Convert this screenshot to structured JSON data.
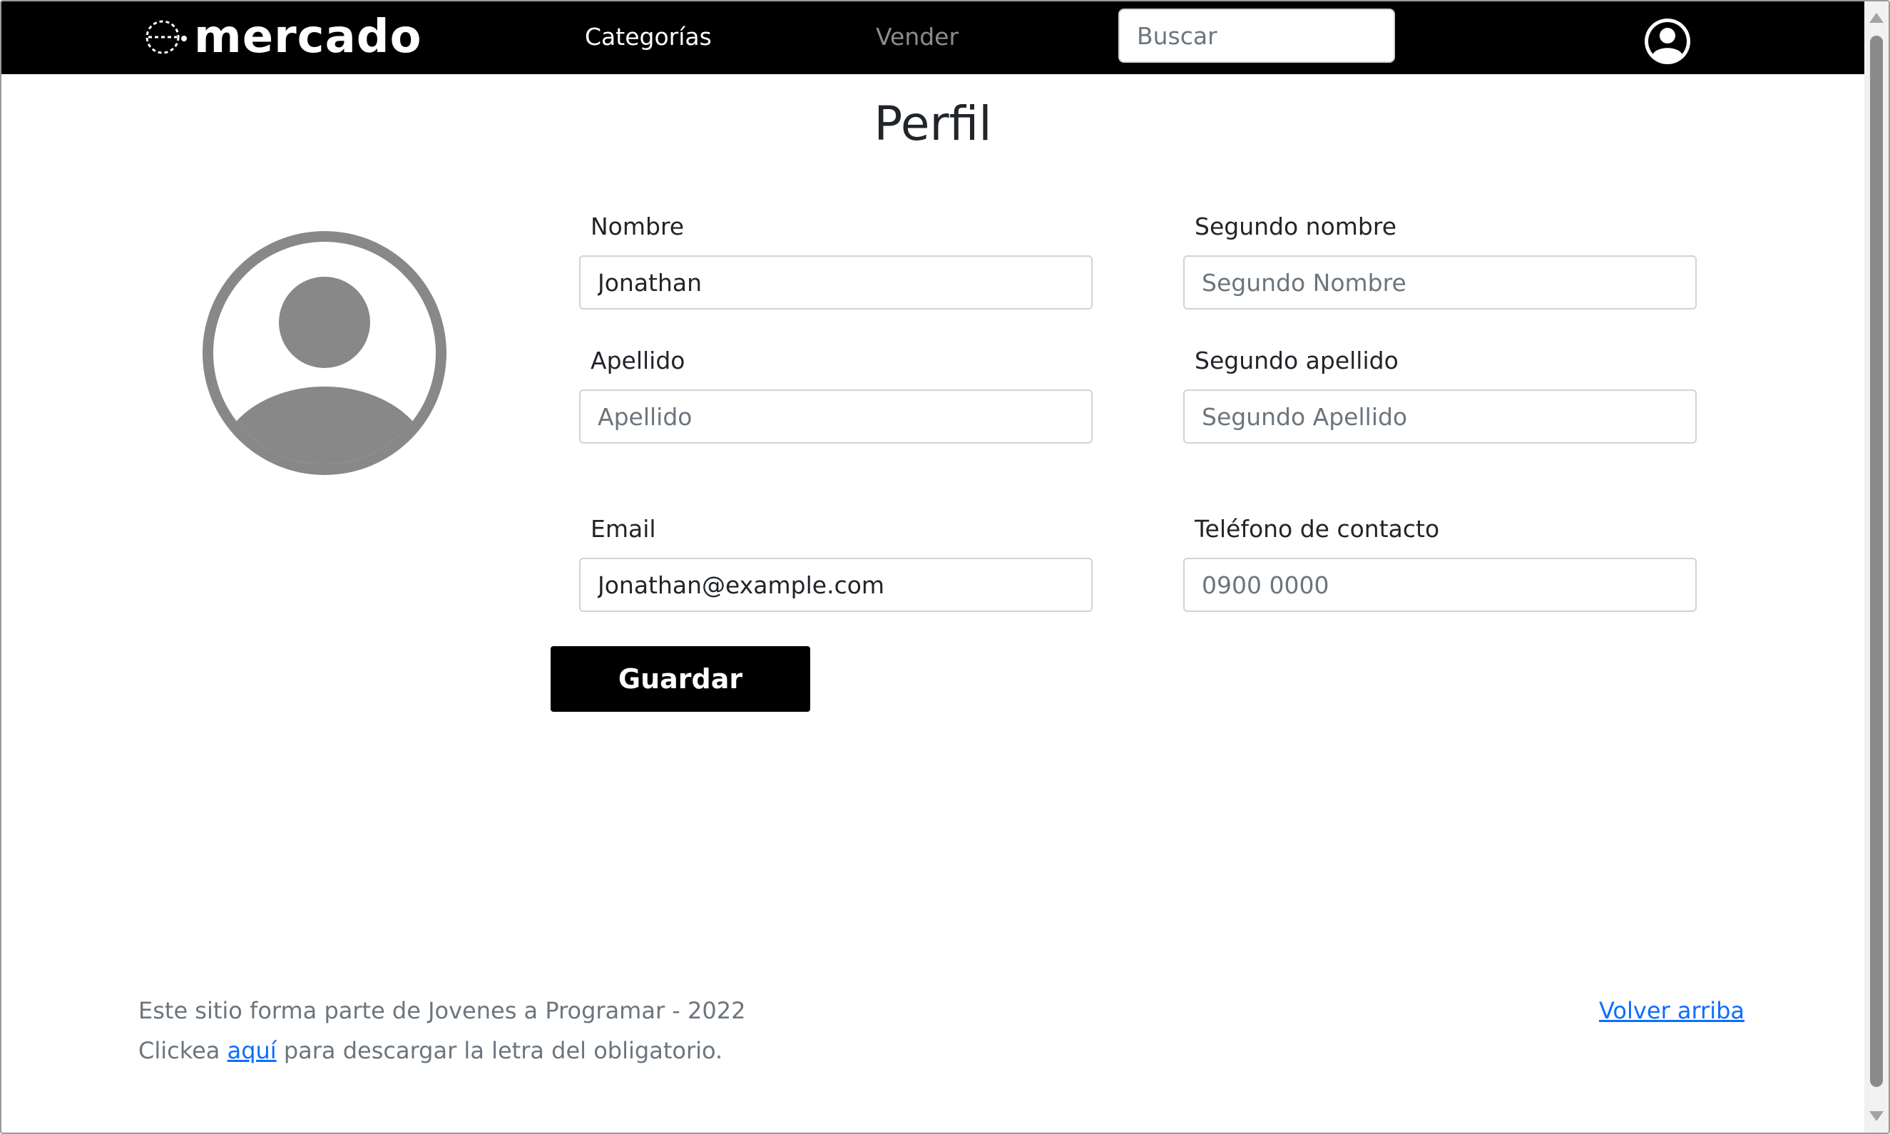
{
  "navbar": {
    "brand": "mercado",
    "links": [
      {
        "label": "Categorías"
      },
      {
        "label": "Vender"
      }
    ],
    "search": {
      "placeholder": "Buscar",
      "value": ""
    }
  },
  "page": {
    "title": "Perfil"
  },
  "form": {
    "nombre": {
      "label": "Nombre",
      "value": "Jonathan",
      "placeholder": ""
    },
    "segundo_nombre": {
      "label": "Segundo nombre",
      "value": "",
      "placeholder": "Segundo Nombre"
    },
    "apellido": {
      "label": "Apellido",
      "value": "",
      "placeholder": "Apellido"
    },
    "segundo_apellido": {
      "label": "Segundo apellido",
      "value": "",
      "placeholder": "Segundo Apellido"
    },
    "email": {
      "label": "Email",
      "value": "Jonathan@example.com",
      "placeholder": ""
    },
    "telefono": {
      "label": "Teléfono de contacto",
      "value": "",
      "placeholder": "0900 0000"
    },
    "save_label": "Guardar"
  },
  "footer": {
    "line1": "Este sitio forma parte de Jovenes a Programar - 2022",
    "line2_prefix": "Clickea ",
    "line2_link": "aquí",
    "line2_suffix": " para descargar la letra del obligatorio.",
    "back_to_top": "Volver arriba"
  },
  "colors": {
    "navbar_bg": "#000000",
    "avatar_gray": "#888888",
    "link_blue": "#0d6efd",
    "button_bg": "#000000"
  },
  "icons": {
    "brand": "dashed-circle-logo-icon",
    "user_nav": "user-circle-icon",
    "avatar": "person-avatar-icon"
  }
}
